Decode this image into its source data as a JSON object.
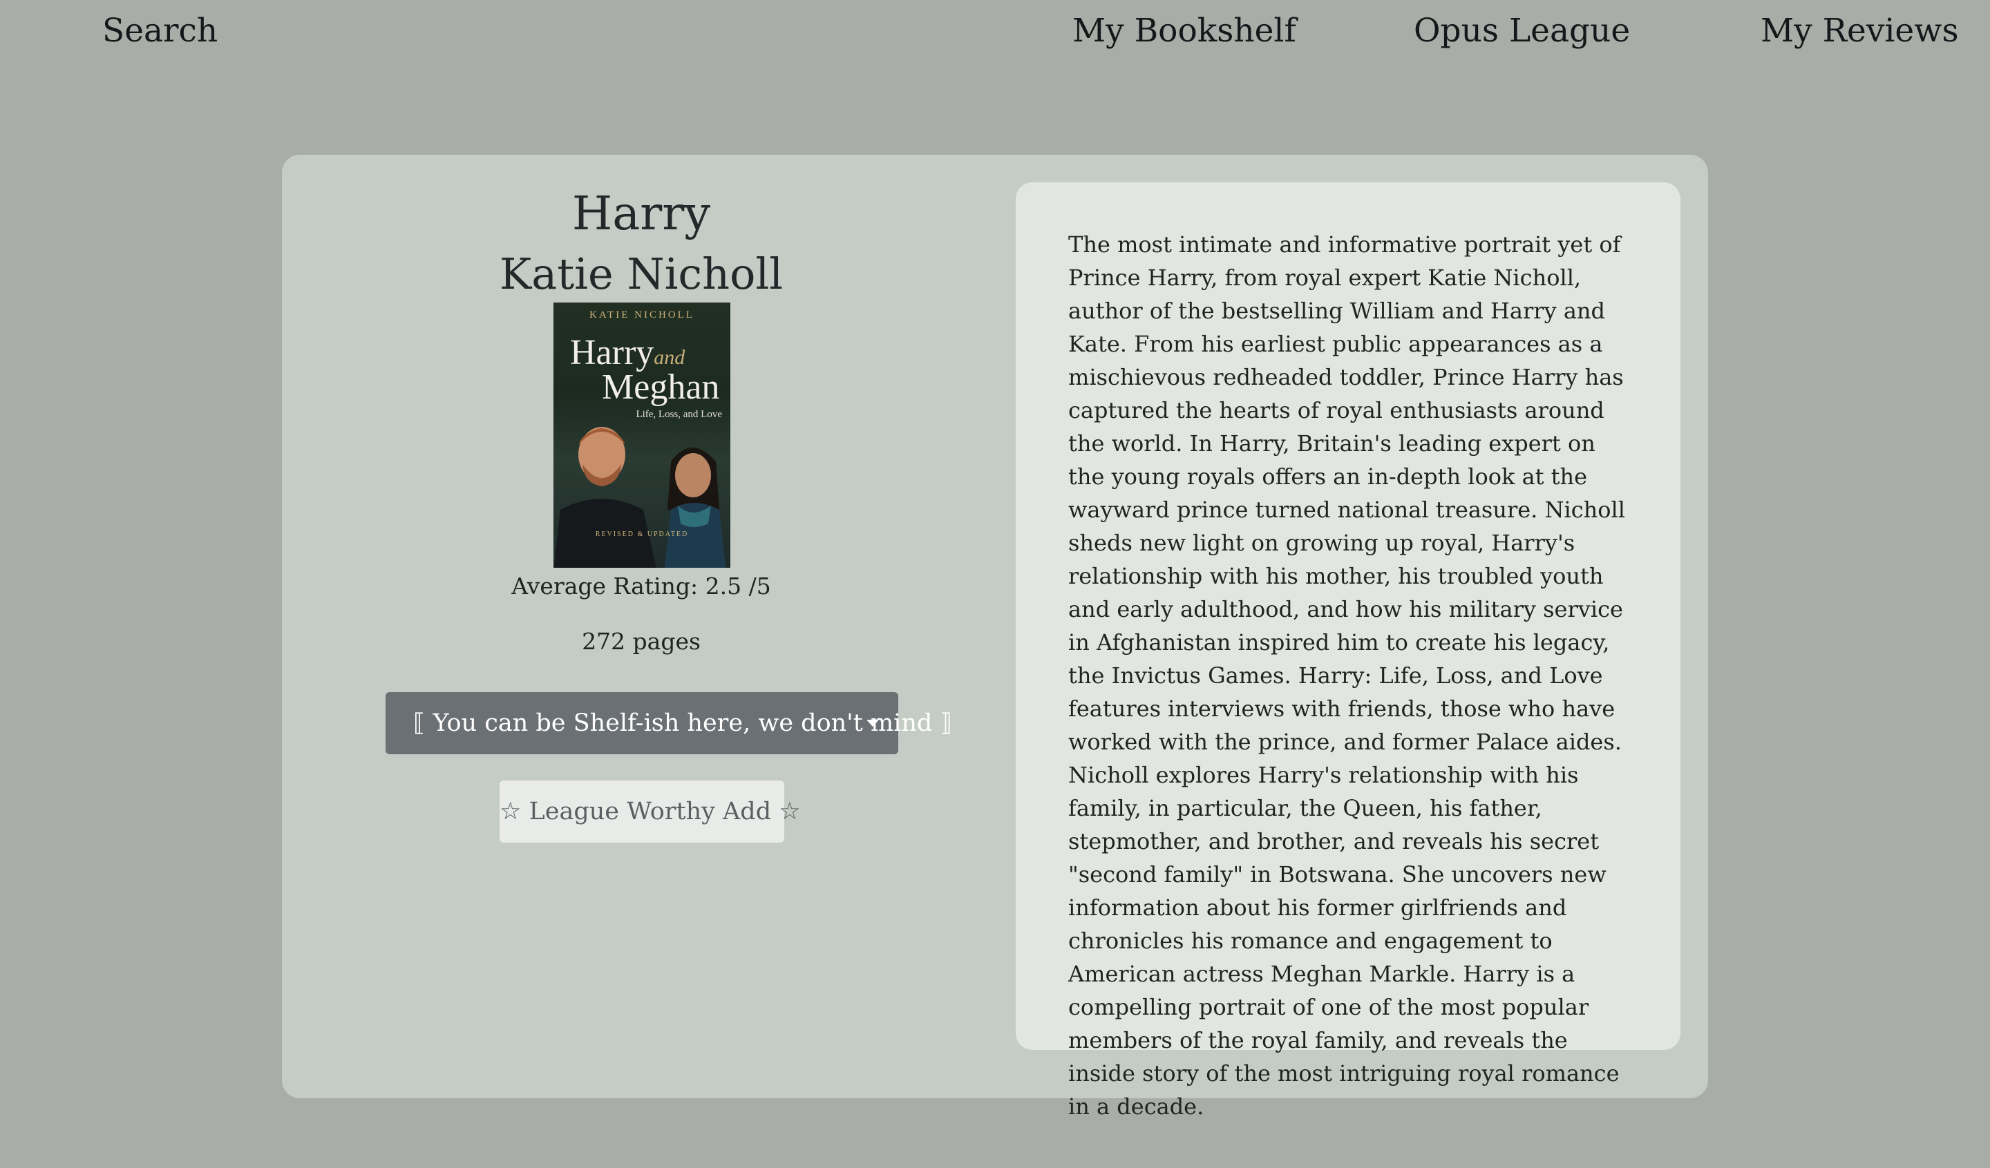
{
  "nav": {
    "search": "Search",
    "bookshelf": "My Bookshelf",
    "league": "Opus League",
    "reviews": "My Reviews"
  },
  "book": {
    "title": "Harry",
    "author": "Katie Nicholl",
    "rating_text": "Average Rating: 2.5 /5",
    "pages_text": "272 pages",
    "cover": {
      "author": "KATIE NICHOLL",
      "title_line1": "Harry",
      "title_and": "and",
      "title_line2": "Meghan",
      "subtitle": "Life, Loss, and Love",
      "badge": "REVISED & UPDATED"
    },
    "description": "The most intimate and informative portrait yet of Prince Harry, from royal expert Katie Nicholl, author of the bestselling William and Harry and Kate. From his earliest public appearances as a mischievous redheaded toddler, Prince Harry has captured the hearts of royal enthusiasts around the world. In Harry, Britain's leading expert on the young royals offers an in-depth look at the wayward prince turned national treasure. Nicholl sheds new light on growing up royal, Harry's relationship with his mother, his troubled youth and early adulthood, and how his military service in Afghanistan inspired him to create his legacy, the Invictus Games. Harry: Life, Loss, and Love features interviews with friends, those who have worked with the prince, and former Palace aides. Nicholl explores Harry's relationship with his family, in particular, the Queen, his father, stepmother, and brother, and reveals his secret \"second family\" in Botswana. She uncovers new information about his former girlfriends and chronicles his romance and engagement to American actress Meghan Markle. Harry is a compelling portrait of one of the most popular members of the royal family, and reveals the inside story of the most intriguing royal romance in a decade."
  },
  "actions": {
    "shelf_dropdown_label": "⟦ You can be Shelf-ish here, we don't mind ⟧",
    "league_button_label": "☆ League Worthy Add ☆"
  },
  "icons": {
    "dropdown_caret": "caret-down-icon"
  },
  "colors": {
    "page_background": "#a8ada7",
    "card_background": "#c5ccc5",
    "description_background": "#e1e6e1",
    "dropdown_background": "#6b7075",
    "league_button_background": "#e8ebe8"
  }
}
